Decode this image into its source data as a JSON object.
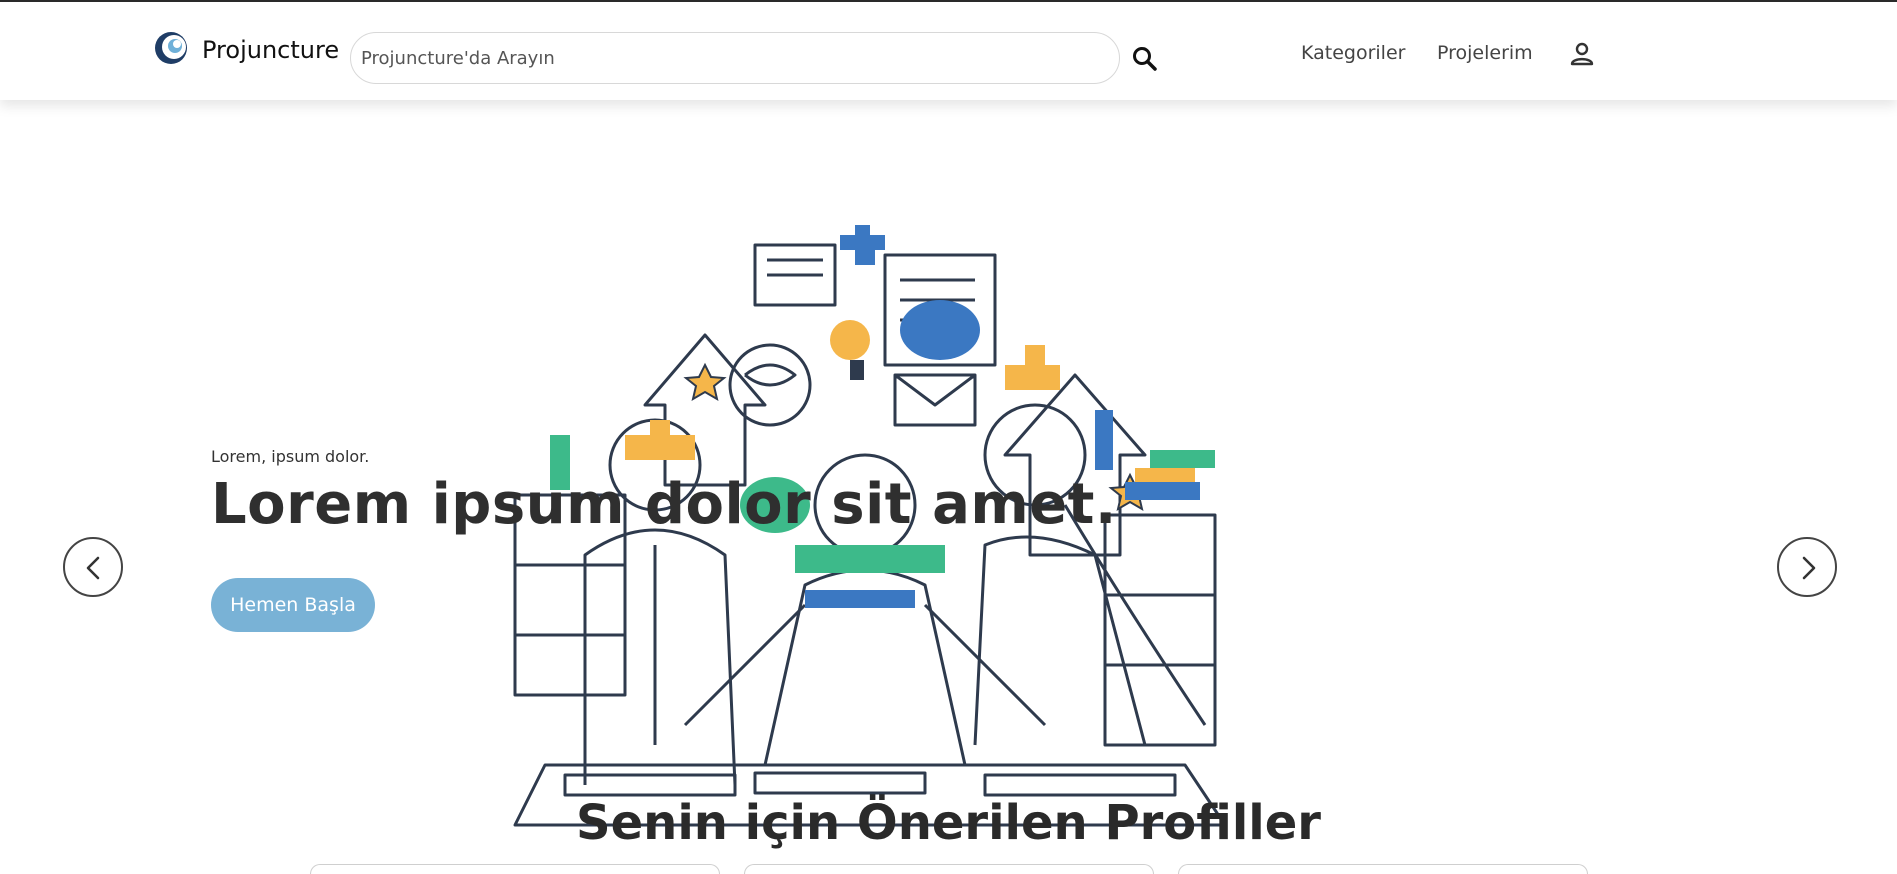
{
  "header": {
    "brand": "Projuncture",
    "search_placeholder": "Projuncture'da Arayın",
    "nav": [
      "Kategoriler",
      "Projelerim"
    ]
  },
  "hero": {
    "eyebrow": "Lorem, ipsum dolor.",
    "title": "Lorem ipsum dolor sit amet.",
    "cta_label": "Hemen Başla"
  },
  "section": {
    "title": "Senin için Önerilen Profiller"
  },
  "colors": {
    "accent": "#79b2d6",
    "text_dark": "#2f2f2f",
    "illus_blue": "#3b78c2",
    "illus_orange": "#f5b64a",
    "illus_green": "#3dba8a",
    "illus_line": "#2e3a4d"
  },
  "icons": [
    "logo-icon",
    "search-icon",
    "user-icon",
    "chevron-left-icon",
    "chevron-right-icon"
  ]
}
